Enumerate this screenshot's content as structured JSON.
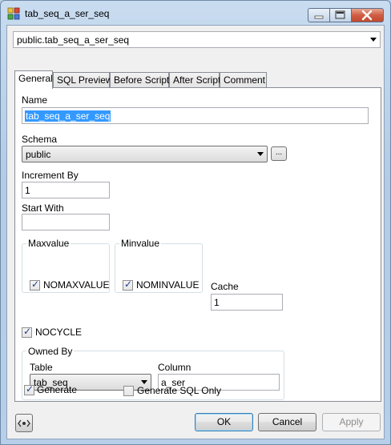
{
  "window": {
    "title": "tab_seq_a_ser_seq",
    "minimize_icon": "minimize-icon",
    "maximize_icon": "maximize-icon",
    "close_icon": "close-icon"
  },
  "object_selector": {
    "value": "public.tab_seq_a_ser_seq"
  },
  "tabs": [
    {
      "label": "General",
      "active": true
    },
    {
      "label": "SQL Preview",
      "active": false
    },
    {
      "label": "Before Script",
      "active": false
    },
    {
      "label": "After Script",
      "active": false
    },
    {
      "label": "Comment",
      "active": false
    }
  ],
  "general": {
    "name_label": "Name",
    "name_value": "tab_seq_a_ser_seq",
    "schema_label": "Schema",
    "schema_value": "public",
    "schema_browse": "...",
    "increment_label": "Increment By",
    "increment_value": "1",
    "start_label": "Start With",
    "start_value": "",
    "maxvalue_title": "Maxvalue",
    "nomaxvalue_label": "NOMAXVALUE",
    "nomaxvalue_checked": true,
    "minvalue_title": "Minvalue",
    "nominvalue_label": "NOMINVALUE",
    "nominvalue_checked": true,
    "cache_label": "Cache",
    "cache_value": "1",
    "nocycle_label": "NOCYCLE",
    "nocycle_checked": true,
    "owned_by_title": "Owned By",
    "table_label": "Table",
    "table_value": "tab_seq",
    "column_label": "Column",
    "column_value": "a_ser"
  },
  "options": {
    "generate_label": "Generate",
    "generate_checked": true,
    "generate_sql_only_label": "Generate SQL Only",
    "generate_sql_only_checked": false
  },
  "footer": {
    "ok_label": "OK",
    "cancel_label": "Cancel",
    "apply_label": "Apply",
    "sql_toggle_icon": "code-toggle-icon"
  },
  "colors": {
    "selection": "#3399ff",
    "title_gradient_top": "#c9dcf0",
    "close_button": "#cf5d44"
  }
}
